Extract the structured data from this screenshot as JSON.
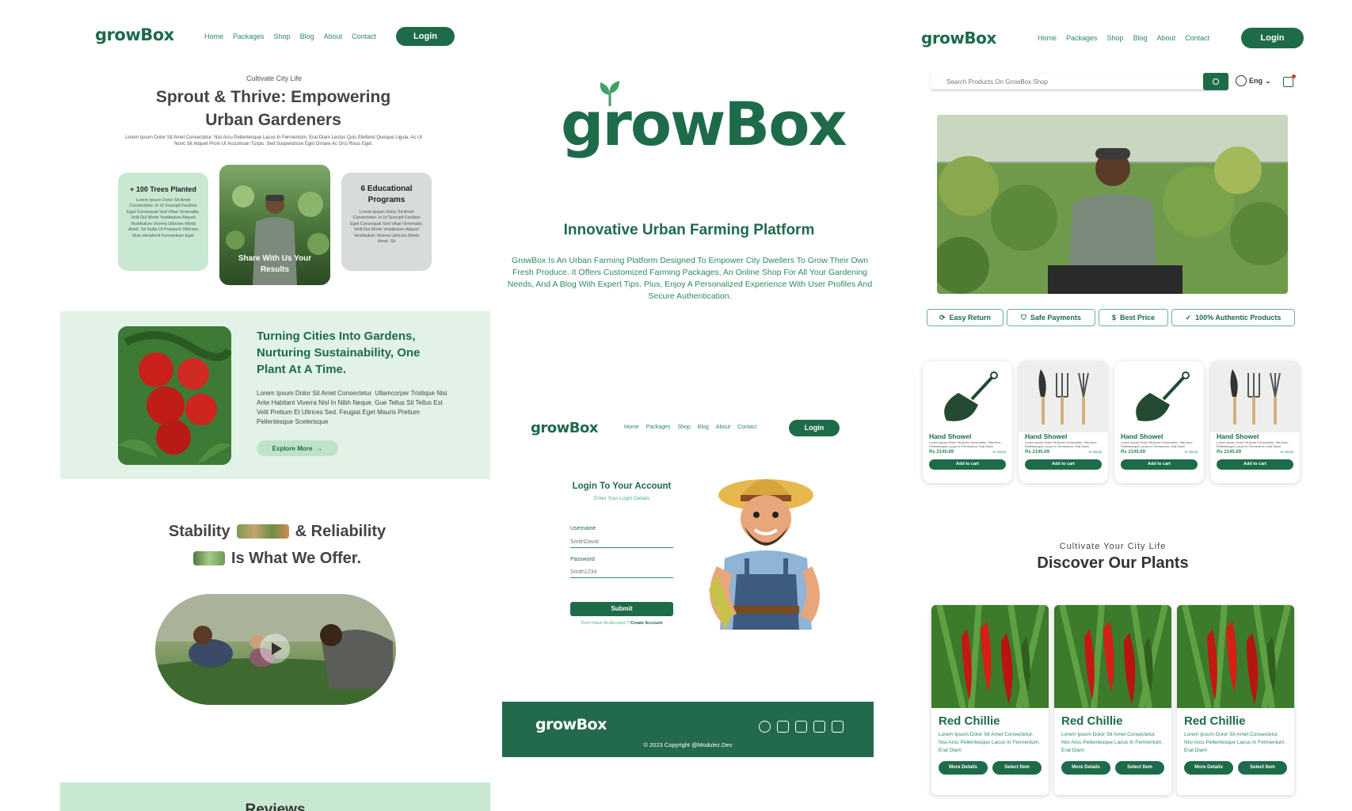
{
  "brand": "growBox",
  "nav": [
    "Home",
    "Packages",
    "Shop",
    "Blog",
    "About",
    "Contact"
  ],
  "login_label": "Login",
  "colors": {
    "primary": "#1e6b4a",
    "light_green": "#e3f2e7",
    "accent": "#2f8a5e"
  },
  "left": {
    "eyebrow": "Cultivate City Life",
    "title_line1": "Sprout & Thrive: Empowering",
    "title_line2": "Urban Gardeners",
    "intro": "Lorem Ipsum Dolor Sit Amet Consectetur. Nisi Arcu Pellentesque Lacus In Fermentum. Erat Diam Lectus Quis Eleifend Quisque Ligula. Ac Ut Nunc Sit Aliquet Proin Ut Accumsan Turpis. Sed Suspendisse Eget Ornare Ac Orci Risus Eget.",
    "card1_title": "+ 100 Trees Planted",
    "card1_text": "Lorem Ipsum Dolor Sit Amet Consectetur. In Id Suscipit Facilisis Eget Consequat Sed Vitae Venenatis. Velit Dui Morbi Vestibulum Aliquet Vestibulum Viverra Ultricies Morbi Amet. Sit Nulla Ut Praesent Ultricies Duis Hendrerit Fermentum Eget",
    "card2_title": "Share With Us Your Results",
    "card3_title": "6 Educational Programs",
    "card3_text": "Lorem Ipsum Dolor Sit Amet Consectetur. In Id Suscipit Facilisis Eget Consequat Sed Vitae Venenatis. Velit Dui Morbi Vestibulum Aliquet Vestibulum Viverra Ultricies Morbi Amet. Sit",
    "mission_title": "Turning Cities Into Gardens, Nurturing Sustainability, One Plant At A Time.",
    "mission_text": "Lorem Ipsum Dolor Sit Amet Consectetur. Ullamcorper Tristique Nisi Ante Habitant Viverra Nisl In Nibh Neque. Gue Tellus Sit Tellus Est Velit Pretium Et Ultrices Sed. Feugiat Eget Mauris Pretium Pellentesque Scelerisque",
    "explore_label": "Explore More",
    "stability_a": "Stability",
    "stability_b": "& Reliability",
    "offer": "Is What We Offer.",
    "reviews": "Reviews"
  },
  "center": {
    "tagline": "Innovative Urban Farming Platform",
    "description": "GrowBox Is An Urban Farming Platform Designed To Empower City Dwellers To Grow Their Own Fresh Produce. It Offers Customized Farming Packages, An Online Shop For All Your Gardening Needs, And A Blog With Expert Tips. Plus, Enjoy A Personalized Experience With User Profiles And Secure Authentication.",
    "login_title": "Login To Your Account",
    "login_sub": "Enter Your Login Details",
    "username_label": "Username",
    "username_placeholder": "SmithDavid",
    "password_label": "Password",
    "password_placeholder": "Smith1234",
    "submit": "Submit",
    "no_account": "Don't Have An Account ?",
    "create_account": "Create Account",
    "copyright": "© 2023 Copyright @Modulez.Dev"
  },
  "right": {
    "search_placeholder": "Search Products On GrowBox Shop",
    "lang": "Eng",
    "features": [
      "Easy Return",
      "Safe Payments",
      "Best Price",
      "100% Authentic Products"
    ],
    "products": [
      {
        "name": "Hand Showel",
        "price": "Rs 2145.69",
        "stock": "In Stock",
        "cta": "Add to cart"
      },
      {
        "name": "Hand Showel",
        "price": "Rs 2145.69",
        "stock": "In Stock",
        "cta": "Add to cart"
      },
      {
        "name": "Hand Showel",
        "price": "Rs 2145.69",
        "stock": "In Stock",
        "cta": "Add to cart"
      },
      {
        "name": "Hand Showel",
        "price": "Rs 2145.69",
        "stock": "In Stock",
        "cta": "Add to cart"
      }
    ],
    "product_text": "Lorem Ipsum Dolor Sit Amet Consectetur. Nisi Arcu Pellentesque Lacus In Fermentum. Erat Diam",
    "plants_eyebrow": "Cultivate Your City Life",
    "plants_title": "Discover Our Plants",
    "plants": [
      {
        "name": "Red Chillie",
        "text": "Lorem Ipsum Dolor Sit Amet Consectetur. Nisi Arcu Pellentesque Lacus In Fermentum. Erat Diam",
        "more": "More Details",
        "select": "Select Item"
      },
      {
        "name": "Red Chillie",
        "text": "Lorem Ipsum Dolor Sit Amet Consectetur. Nisi Arcu Pellentesque Lacus In Fermentum. Erat Diam",
        "more": "More Details",
        "select": "Select Item"
      },
      {
        "name": "Red Chillie",
        "text": "Lorem Ipsum Dolor Sit Amet Consectetur. Nisi Arcu Pellentesque Lacus In Fermentum. Erat Diam",
        "more": "More Details",
        "select": "Select Item"
      }
    ]
  }
}
